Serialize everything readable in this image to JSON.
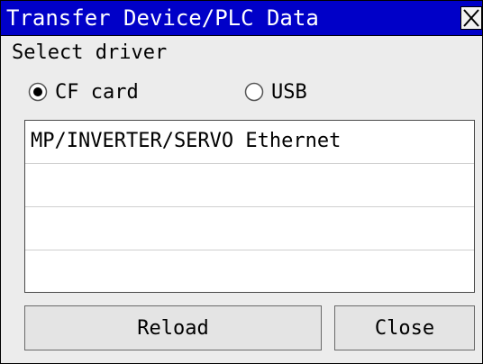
{
  "window": {
    "title": "Transfer Device/PLC Data",
    "close_icon": "close-icon"
  },
  "driver": {
    "label": "Select driver",
    "options": [
      {
        "label": "CF card",
        "selected": true
      },
      {
        "label": "USB",
        "selected": false
      }
    ]
  },
  "list": {
    "rows": [
      "MP/INVERTER/SERVO Ethernet",
      "",
      "",
      ""
    ]
  },
  "buttons": {
    "reload": "Reload",
    "close": "Close"
  },
  "colors": {
    "titlebar": "#0000c8",
    "background": "#ececec"
  }
}
